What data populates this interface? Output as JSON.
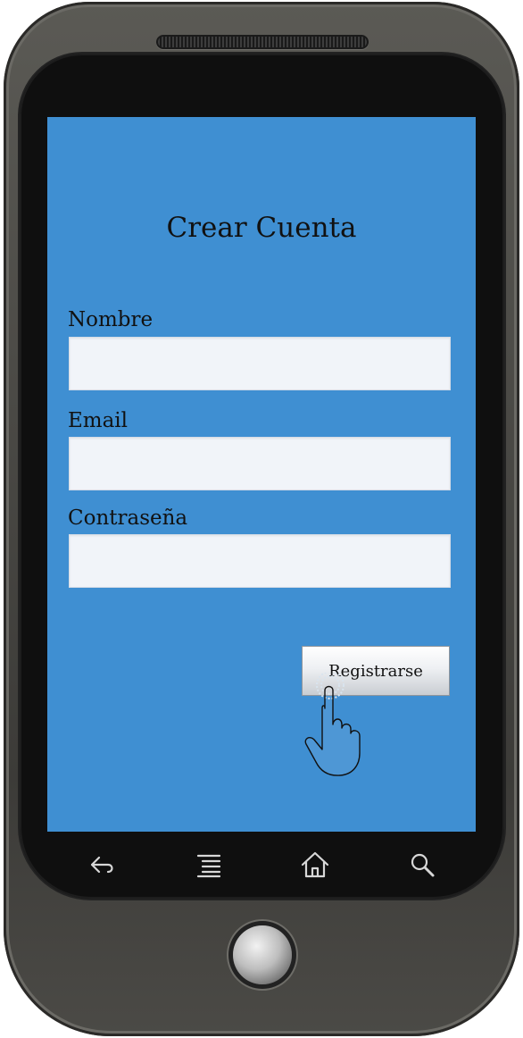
{
  "device": {
    "nav_icons": [
      "back-icon",
      "menu-icon",
      "home-icon",
      "search-icon"
    ]
  },
  "screen": {
    "title": "Crear Cuenta",
    "fields": [
      {
        "label": "Nombre",
        "value": ""
      },
      {
        "label": "Email",
        "value": ""
      },
      {
        "label": "Contraseña",
        "value": ""
      }
    ],
    "submit_label": "Registrarse",
    "background_color": "#3f8fd2"
  }
}
